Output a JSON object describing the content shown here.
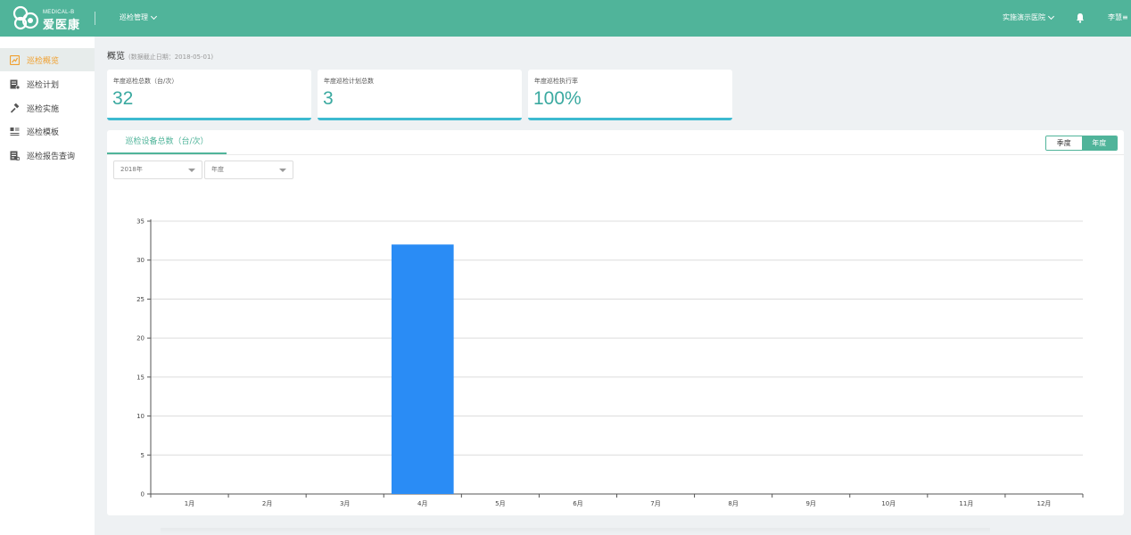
{
  "header": {
    "logo_en": "MEDICAL-B",
    "logo_cn": "爱医康",
    "menu_label": "巡检管理",
    "hospital_label": "实施演示医院",
    "user_label": "李慧≡"
  },
  "sidebar": {
    "items": [
      {
        "label": "巡检概览",
        "icon": "overview-icon",
        "active": true
      },
      {
        "label": "巡检计划",
        "icon": "plan-icon",
        "active": false
      },
      {
        "label": "巡检实施",
        "icon": "hammer-icon",
        "active": false
      },
      {
        "label": "巡检模板",
        "icon": "template-icon",
        "active": false
      },
      {
        "label": "巡检报告查询",
        "icon": "report-icon",
        "active": false
      }
    ]
  },
  "overview": {
    "title": "概览",
    "date_note": "(数据截止日期：2018-05-01)"
  },
  "cards": [
    {
      "label": "年度巡检总数（台/次）",
      "value": "32"
    },
    {
      "label": "年度巡检计划总数",
      "value": "3"
    },
    {
      "label": "年度巡检执行率",
      "value": "100%"
    }
  ],
  "panel": {
    "tab_label": "巡检设备总数（台/次）",
    "toggle_quarter": "季度",
    "toggle_year": "年度",
    "year_select": "2018年",
    "period_select": "年度"
  },
  "colors": {
    "brand": "#50b49a",
    "accent_active": "#f0a030",
    "card_border": "#3dbad0",
    "bar": "#2a8cf5"
  },
  "chart_data": {
    "type": "bar",
    "categories": [
      "1月",
      "2月",
      "3月",
      "4月",
      "5月",
      "6月",
      "7月",
      "8月",
      "9月",
      "10月",
      "11月",
      "12月"
    ],
    "values": [
      0,
      0,
      0,
      32,
      0,
      0,
      0,
      0,
      0,
      0,
      0,
      0
    ],
    "ylim": [
      0,
      35
    ],
    "yticks": [
      0,
      5,
      10,
      15,
      20,
      25,
      30,
      35
    ],
    "grid": true
  }
}
